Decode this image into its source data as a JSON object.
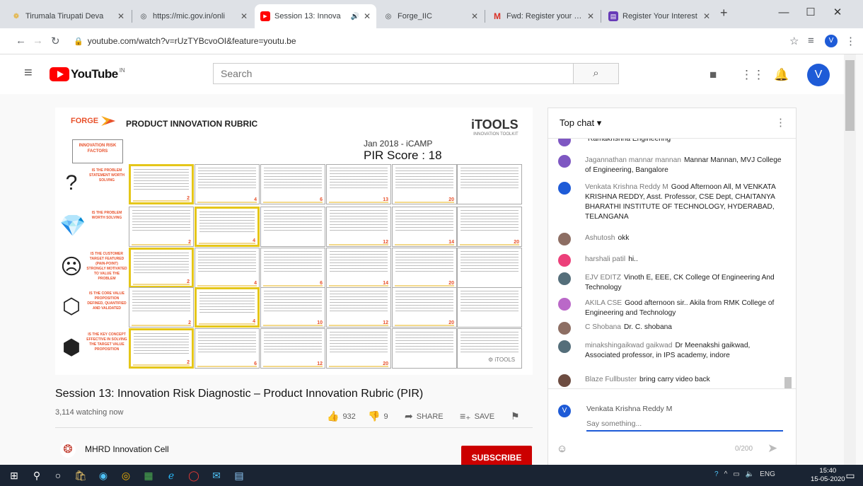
{
  "browser": {
    "tabs": [
      {
        "title": "Tirumala Tirupati Deva",
        "favicon_color": "#e6a817",
        "favicon": "❁",
        "active": false
      },
      {
        "title": "https://mic.gov.in/onli",
        "favicon_color": "#5f6368",
        "favicon": "◎",
        "active": false
      },
      {
        "title": "Session 13: Innova",
        "favicon_color": "#ff0000",
        "favicon": "▶",
        "active": true,
        "audio": "🔊"
      },
      {
        "title": "Forge_IIC",
        "favicon_color": "#5f6368",
        "favicon": "◎",
        "active": false
      },
      {
        "title": "Fwd: Register your Inte",
        "favicon_color": "#d93025",
        "favicon": "M",
        "active": false
      },
      {
        "title": "Register Your Interest",
        "favicon_color": "#673ab7",
        "favicon": "▤",
        "active": false
      }
    ],
    "new_tab": "+",
    "window_controls": {
      "minimize": "—",
      "maximize": "☐",
      "close": "✕"
    },
    "url": "youtube.com/watch?v=rUzTYBcvoOI&feature=youtu.be",
    "profile_initial": "V"
  },
  "youtube": {
    "logo_text": "YouTube",
    "logo_region": "IN",
    "search_placeholder": "Search",
    "avatar_initial": "V"
  },
  "slide": {
    "brand": "FORGE",
    "title": "PRODUCT INNOVATION RUBRIC",
    "itools": "iTOOLS",
    "itools_tag": "INNOVATION TOOLKIT",
    "date": "Jan 2018 - iCAMP",
    "score": "PIR Score : 18",
    "header_label": "INNOVATION RISK FACTORS",
    "rows": [
      {
        "icon": "?",
        "label": "IS THE PROBLEM STATEMENT WORTH SOLVING",
        "scores": [
          "2",
          "4",
          "6",
          "13",
          "20",
          ""
        ],
        "selected": 0
      },
      {
        "icon": "💎",
        "label": "IS THE PROBLEM WORTH SOLVING",
        "scores": [
          "2",
          "4",
          "",
          "12",
          "14",
          "20"
        ],
        "selected": 1
      },
      {
        "icon": "☹",
        "label": "IS THE CUSTOMER TARGET FEATURED (PAIN-POINT) STRONGLY MOTIVATED TO VALUE THE PROBLEM",
        "scores": [
          "2",
          "4",
          "6",
          "14",
          "20",
          ""
        ],
        "selected": 0
      },
      {
        "icon": "⬡",
        "label": "IS THE CORE VALUE PROPOSITION DEFINED, QUANTIFIED AND VALIDATED",
        "scores": [
          "2",
          "4",
          "10",
          "12",
          "20",
          ""
        ],
        "selected": 1
      },
      {
        "icon": "⬢",
        "label": "IS THE KEY CONCEPT EFFECTIVE IN SOLVING THE TARGET VALUE PROPOSITION",
        "scores": [
          "2",
          "6",
          "12",
          "20",
          "",
          ""
        ],
        "selected": 0
      }
    ],
    "footer_logo": "⚙ iTOOLS"
  },
  "video": {
    "title": "Session 13: Innovation Risk Diagnostic – Product Innovation Rubric (PIR)",
    "viewers": "3,114 watching now",
    "likes": "932",
    "dislikes": "9",
    "share_label": "SHARE",
    "save_label": "SAVE",
    "channel_name": "MHRD Innovation Cell",
    "subscribe_label": "SUBSCRIBE"
  },
  "chat": {
    "mode_label": "Top chat",
    "messages": [
      {
        "author": "",
        "text": "Ramakrishna Engineering",
        "avatar_color": "#7e57c2"
      },
      {
        "author": "Jagannathan mannar mannan",
        "text": "Mannar Mannan, MVJ College of Engineering, Bangalore",
        "avatar_color": "#7e57c2"
      },
      {
        "author": "Venkata Krishna Reddy M",
        "text": "Good Afternoon All, M VENKATA KRISHNA REDDY, Asst. Professor, CSE Dept, CHAITANYA BHARATHI INSTITUTE OF TECHNOLOGY, HYDERABAD, TELANGANA",
        "avatar_color": "#1e5bd7"
      },
      {
        "author": "Ashutosh",
        "text": "okk",
        "avatar_color": "#8d6e63"
      },
      {
        "author": "harshali patil",
        "text": "hi..",
        "avatar_color": "#ec407a"
      },
      {
        "author": "EJV EDITZ",
        "text": "Vinoth E, EEE, CK College Of Engineering And Technology",
        "avatar_color": "#546e7a"
      },
      {
        "author": "AKILA CSE",
        "text": "Good afternoon sir.. Akila from RMK College of Engineering and Technology",
        "avatar_color": "#ba68c8"
      },
      {
        "author": "C Shobana",
        "text": "Dr. C. shobana",
        "avatar_color": "#8d6e63"
      },
      {
        "author": "minakshingaikwad gaikwad",
        "text": "Dr Meenakshi gaikwad, Associated professor, in IPS academy, indore",
        "avatar_color": "#546e7a"
      },
      {
        "author": "Blaze Fullbuster",
        "text": "bring carry video back",
        "avatar_color": "#6d4c41"
      }
    ],
    "current_user": "Venkata Krishna Reddy M",
    "input_placeholder": "Say something...",
    "char_count": "0/200"
  },
  "taskbar": {
    "tray_lang": "ENG",
    "time": "15:40",
    "date": "15-05-2020"
  }
}
